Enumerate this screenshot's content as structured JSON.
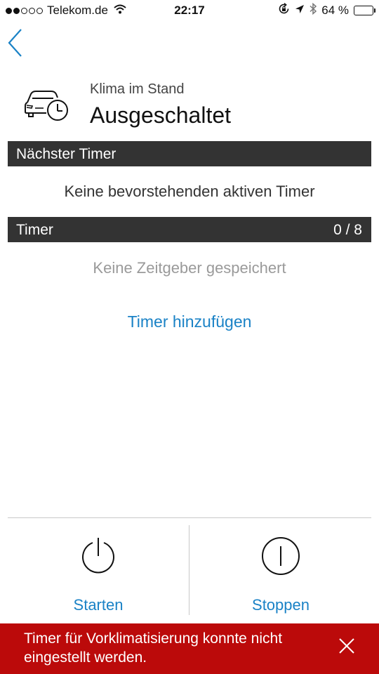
{
  "status_bar": {
    "carrier": "Telekom.de",
    "time": "22:17",
    "battery": "64 %",
    "battery_level": 0.64,
    "signal_strength": 2
  },
  "header": {
    "subtitle": "Klima im Stand",
    "title": "Ausgeschaltet"
  },
  "next_timer": {
    "label": "Nächster Timer",
    "empty_text": "Keine bevorstehenden aktiven Timer"
  },
  "timers": {
    "label": "Timer",
    "count": "0 / 8",
    "empty_text": "Keine Zeitgeber gespeichert",
    "add_label": "Timer hinzufügen"
  },
  "actions": {
    "start_label": "Starten",
    "stop_label": "Stoppen"
  },
  "error": {
    "message": "Timer für Vorklimatisierung konnte nicht eingestellt werden."
  },
  "colors": {
    "accent": "#1a82c6",
    "section_bar": "#333333",
    "error": "#bb0a0a"
  }
}
